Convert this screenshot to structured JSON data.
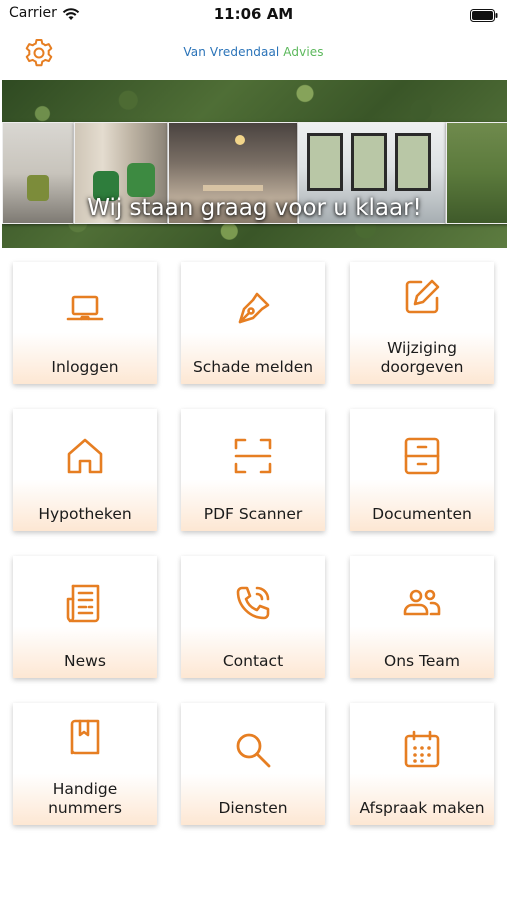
{
  "status_bar": {
    "carrier": "Carrier",
    "time": "11:06 AM"
  },
  "header": {
    "brand_part1": "Van Vredendaal",
    "brand_part2": "Advies"
  },
  "banner": {
    "tagline": "Wij staan graag voor u klaar!"
  },
  "accent_color": "#e67e22",
  "tiles": [
    {
      "label": "Inloggen",
      "icon": "laptop-icon"
    },
    {
      "label": "Schade melden",
      "icon": "pen-nib-icon"
    },
    {
      "label": "Wijziging doorgeven",
      "icon": "edit-icon"
    },
    {
      "label": "Hypotheken",
      "icon": "home-icon"
    },
    {
      "label": "PDF Scanner",
      "icon": "scan-icon"
    },
    {
      "label": "Documenten",
      "icon": "archive-icon"
    },
    {
      "label": "News",
      "icon": "newspaper-icon"
    },
    {
      "label": "Contact",
      "icon": "phone-call-icon"
    },
    {
      "label": "Ons Team",
      "icon": "team-icon"
    },
    {
      "label": "Handige nummers",
      "icon": "bookmark-book-icon"
    },
    {
      "label": "Diensten",
      "icon": "search-icon"
    },
    {
      "label": "Afspraak maken",
      "icon": "calendar-icon"
    }
  ]
}
